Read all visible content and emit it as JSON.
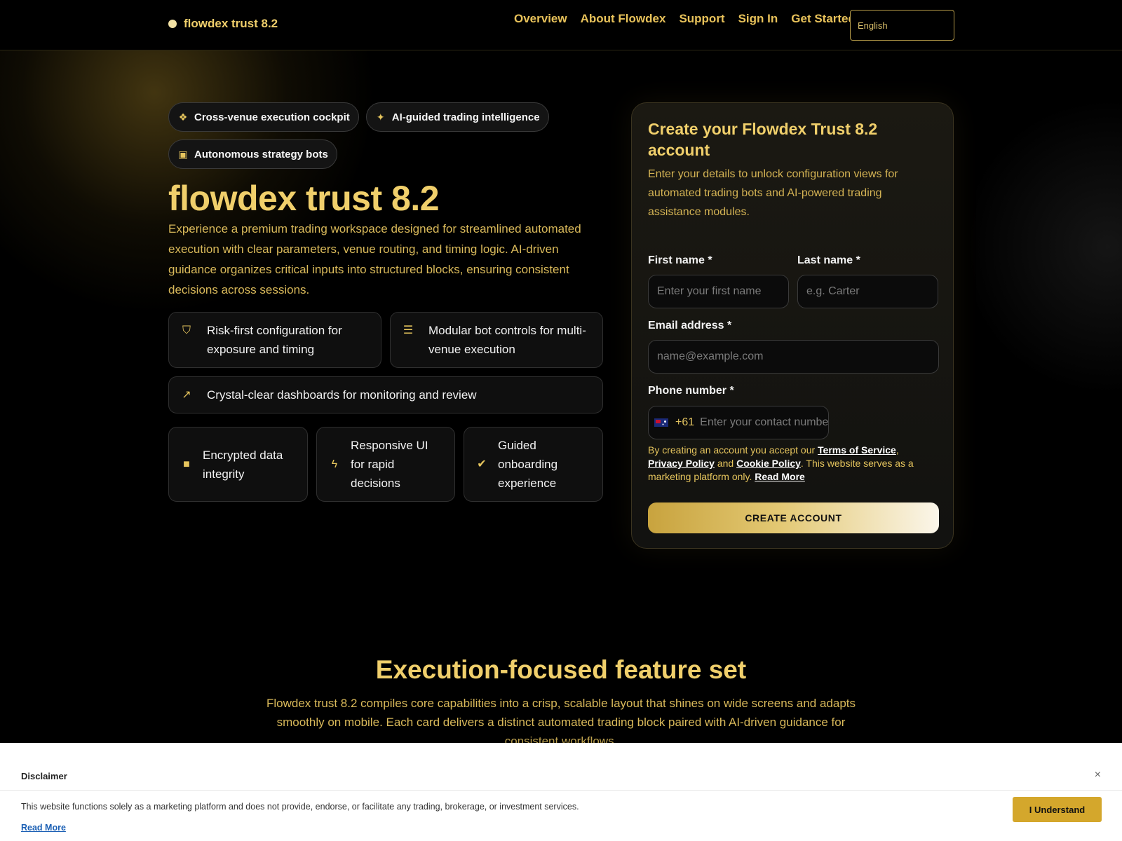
{
  "header": {
    "brand": "flowdex trust 8.2",
    "nav": [
      "Overview",
      "About Flowdex",
      "Support",
      "Sign In",
      "Get Started"
    ],
    "language": "English"
  },
  "hero": {
    "chips": [
      {
        "icon": "cubes-icon",
        "label": "Cross-venue execution cockpit"
      },
      {
        "icon": "magic-wand-icon",
        "label": "AI-guided trading intelligence"
      },
      {
        "icon": "robot-icon",
        "label": "Autonomous strategy bots"
      }
    ],
    "title": "flowdex trust 8.2",
    "description": "Experience a premium trading workspace designed for streamlined automated execution with clear parameters, venue routing, and timing logic. AI-driven guidance organizes critical inputs into structured blocks, ensuring consistent decisions across sessions.",
    "features": [
      {
        "icon": "shield-icon",
        "text": "Risk-first configuration for exposure and timing"
      },
      {
        "icon": "sliders-icon",
        "text": "Modular bot controls for multi-venue execution"
      },
      {
        "icon": "line-chart-icon",
        "text": "Crystal-clear dashboards for monitoring and review"
      },
      {
        "icon": "lock-icon",
        "text": "Encrypted data integrity"
      },
      {
        "icon": "bolt-icon",
        "text": "Responsive UI for rapid decisions"
      },
      {
        "icon": "check-circle-icon",
        "text": "Guided onboarding experience"
      }
    ]
  },
  "form": {
    "title": "Create your Flowdex Trust 8.2 account",
    "subtitle": "Enter your details to unlock configuration views for automated trading bots and AI-powered trading assistance modules.",
    "first_name_label": "First name *",
    "first_name_placeholder": "Enter your first name",
    "last_name_label": "Last name *",
    "last_name_placeholder": "e.g. Carter",
    "email_label": "Email address *",
    "email_placeholder": "name@example.com",
    "phone_label": "Phone number *",
    "phone_dial_code": "+61",
    "phone_placeholder": "Enter your contact number",
    "terms_prefix": "By creating an account you accept our ",
    "terms_link": "Terms of Service",
    "privacy_link": "Privacy Policy",
    "and_text": " and ",
    "cookie_link": "Cookie Policy",
    "terms_suffix": ". This website serves as a marketing platform only. ",
    "read_more": "Read More",
    "submit": "CREATE ACCOUNT"
  },
  "section": {
    "title": "Execution-focused feature set",
    "description": "Flowdex trust 8.2 compiles core capabilities into a crisp, scalable layout that shines on wide screens and adapts smoothly on mobile. Each card delivers a distinct automated trading block paired with AI-driven guidance for consistent workflows."
  },
  "disclaimer": {
    "title": "Disclaimer",
    "text": "This website functions solely as a marketing platform and does not provide, endorse, or facilitate any trading, brokerage, or investment services.",
    "read_more": "Read More",
    "button": "I Understand",
    "close": "×"
  }
}
